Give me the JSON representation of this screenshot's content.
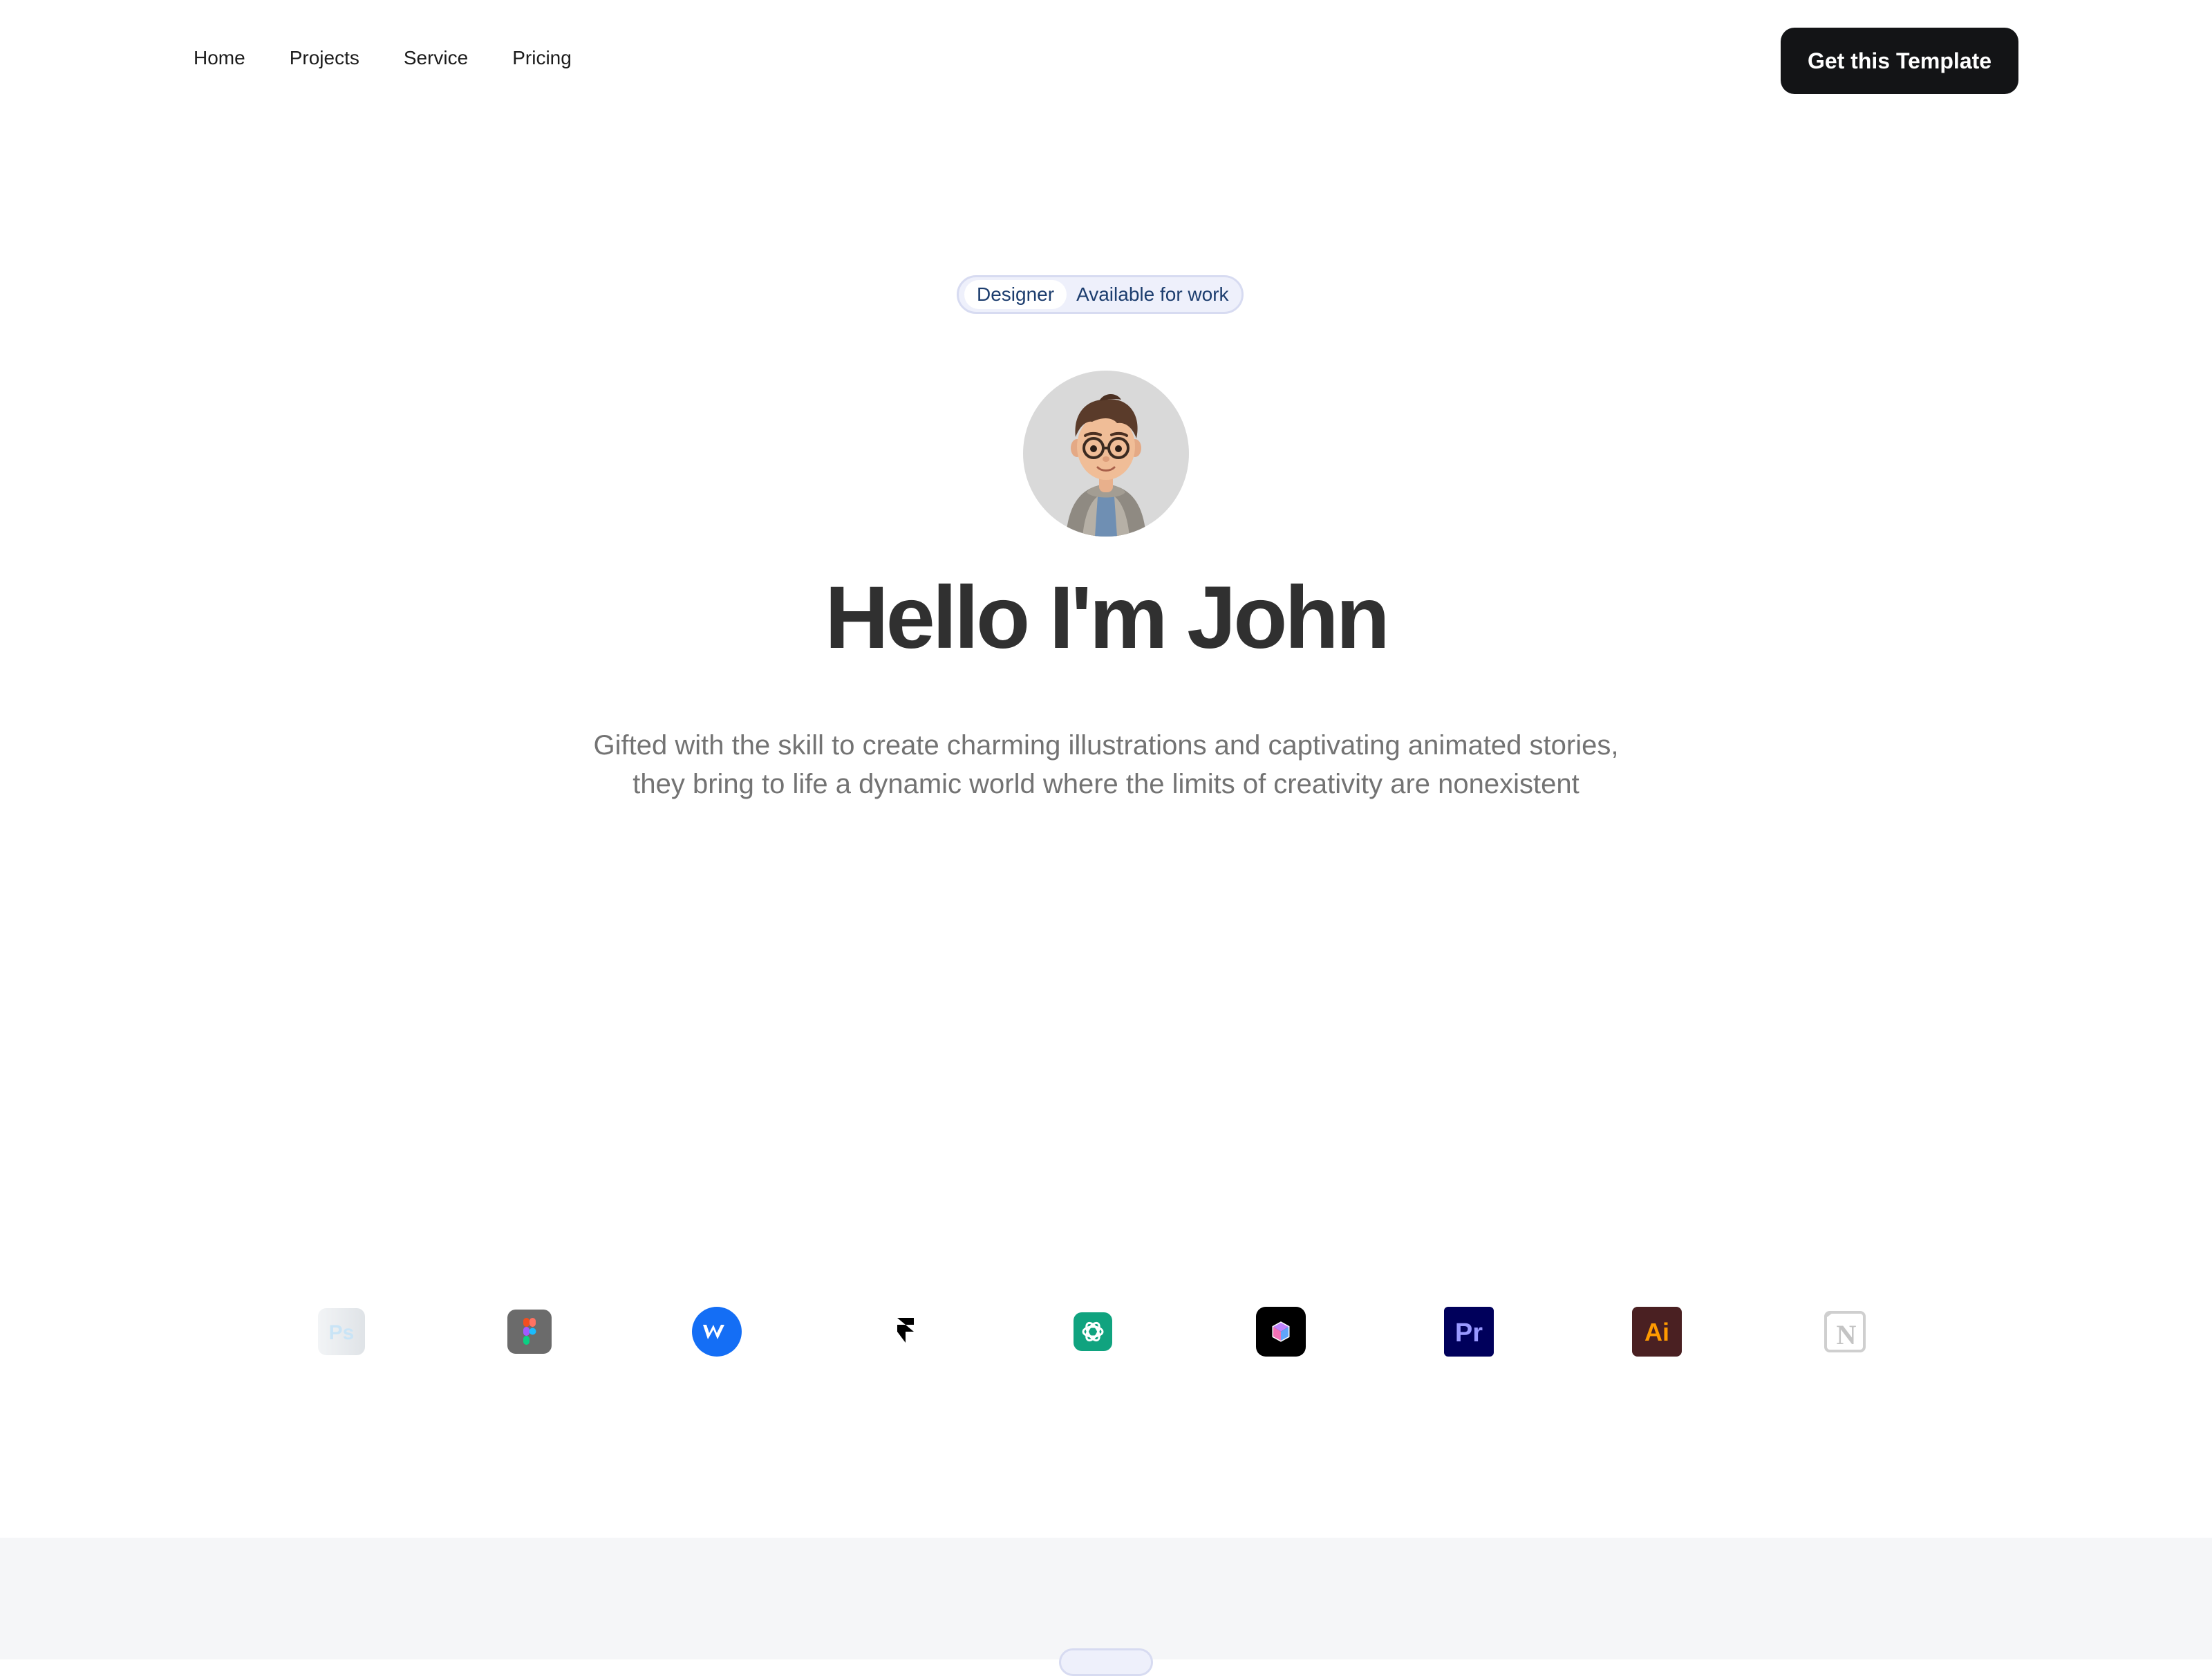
{
  "nav": {
    "links": [
      {
        "label": "Home"
      },
      {
        "label": "Projects"
      },
      {
        "label": "Service"
      },
      {
        "label": "Pricing"
      }
    ],
    "cta_label": "Get this Template"
  },
  "hero": {
    "badge_role": "Designer",
    "badge_status": "Available for work",
    "avatar_icon": "avatar-3d-character-icon",
    "title": "Hello I'm John",
    "subtitle": "Gifted with the skill to create charming illustrations and captivating animated stories, they bring to life a dynamic world where the limits of creativity are nonexistent"
  },
  "tools": [
    {
      "name": "photoshop",
      "icon": "photoshop-icon",
      "glyph": "Ps",
      "color": "#31a8ff"
    },
    {
      "name": "figma",
      "icon": "figma-icon",
      "color": "#6b6b6b"
    },
    {
      "name": "webflow",
      "icon": "webflow-icon",
      "color": "#146ef5"
    },
    {
      "name": "framer",
      "icon": "framer-icon",
      "color": "#000000"
    },
    {
      "name": "chatgpt",
      "icon": "chatgpt-icon",
      "color": "#10a37f"
    },
    {
      "name": "spline",
      "icon": "spline-icon",
      "color": "#000000"
    },
    {
      "name": "premiere-pro",
      "icon": "premiere-pro-icon",
      "glyph": "Pr",
      "color": "#00005b"
    },
    {
      "name": "illustrator",
      "icon": "illustrator-icon",
      "glyph": "Ai",
      "color": "#ff9a00"
    },
    {
      "name": "notion",
      "icon": "notion-icon",
      "glyph": "N",
      "color": "#bdbdbd"
    }
  ],
  "colors": {
    "cta_bg": "#131416",
    "badge_bg": "#eef0fb",
    "badge_text": "#1c3d6e",
    "headline": "#303030",
    "subtitle": "#737373",
    "band_bg": "#f5f6f8"
  }
}
